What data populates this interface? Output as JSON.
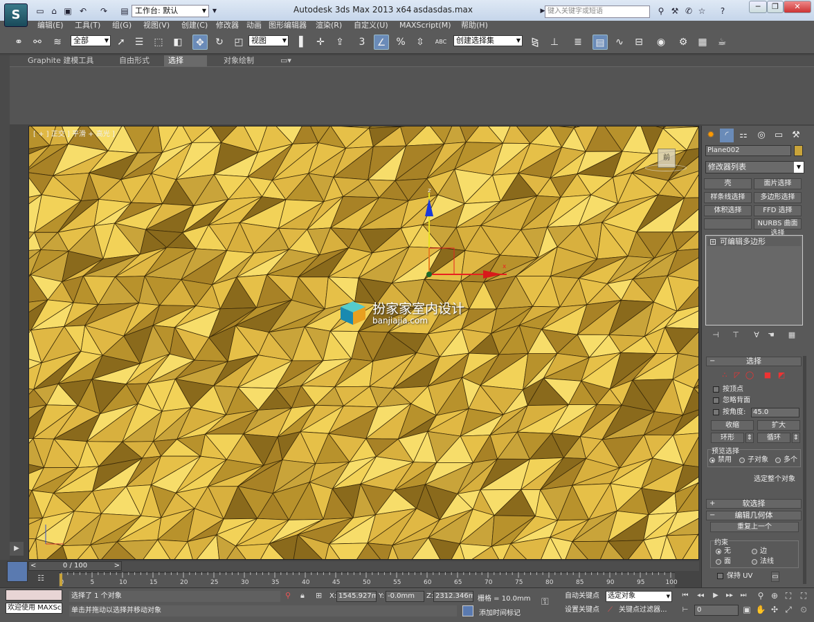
{
  "titlebar": {
    "workspace_label": "工作台: 默认",
    "title": "Autodesk 3ds Max  2013 x64",
    "filename": "asdasdas.max",
    "search_placeholder": "键入关键字或短语",
    "help": "?"
  },
  "menu": [
    "编辑(E)",
    "工具(T)",
    "组(G)",
    "视图(V)",
    "创建(C)",
    "修改器",
    "动画",
    "图形编辑器",
    "渲染(R)",
    "自定义(U)",
    "MAXScript(M)",
    "帮助(H)"
  ],
  "toolbar": {
    "filter_value": "全部",
    "ref_coord_value": "视图",
    "named_sel_placeholder": "创建选择集",
    "snap_label": "3",
    "abc_label": "ABC"
  },
  "ribbon": {
    "tabs": [
      "Graphite 建模工具",
      "自由形式",
      "选择",
      "对象绘制"
    ],
    "active_tab": "选择"
  },
  "viewport": {
    "label": "[ + ] 正交 ] 平滑 + 高光 ]",
    "viewcube_face": "前",
    "gizmo_z": "z",
    "gizmo_x": "x",
    "mesh_color": "#c9a43a",
    "watermark_title": "扮家家室内设计",
    "watermark_url": "banjiajia.com"
  },
  "command_panel": {
    "object_name": "Plane002",
    "object_color": "#c9a43a",
    "modifier_list": "修改器列表",
    "modifier_buttons": [
      "壳",
      "面片选择",
      "样条线选择",
      "多边形选择",
      "体积选择",
      "FFD 选择",
      "",
      "NURBS 曲面选择"
    ],
    "stack_item": "可编辑多边形",
    "selection_rollout": "选择",
    "by_vertex": "按顶点",
    "ignore_backfacing": "忽略背面",
    "by_angle": "按角度:",
    "angle_value": "45.0",
    "shrink": "收缩",
    "grow": "扩大",
    "ring": "环形",
    "loop": "循环",
    "preview_selection": "预览选择",
    "preview_options": [
      "禁用",
      "子对象",
      "多个"
    ],
    "select_whole": "选定整个对象",
    "soft_selection": "软选择",
    "edit_geometry": "编辑几何体",
    "repeat_last": "重复上一个",
    "constraints": "约束",
    "constraint_options": [
      "无",
      "边",
      "面",
      "法线"
    ],
    "preserve_uv": "保持 UV"
  },
  "timeline": {
    "slider_label": "0 / 100",
    "ticks": [
      "0",
      "5",
      "10",
      "15",
      "20",
      "25",
      "30",
      "35",
      "40",
      "45",
      "50",
      "55",
      "60",
      "65",
      "70",
      "75",
      "80",
      "85",
      "90",
      "95",
      "100"
    ]
  },
  "status": {
    "welcome": "欢迎使用 MAXScr",
    "selected": "选择了 1 个对象",
    "prompt": "单击并拖动以选择并移动对象",
    "x_label": "X:",
    "x_value": "1545.927m",
    "y_label": "Y:",
    "y_value": "-0.0mm",
    "z_label": "Z:",
    "z_value": "2312.346m",
    "grid": "栅格 = 10.0mm",
    "add_time_tag": "添加时间标记",
    "auto_key": "自动关键点",
    "set_key": "设置关键点",
    "selected_object": "选定对象",
    "key_filters": "关键点过滤器...",
    "frame": "0"
  }
}
